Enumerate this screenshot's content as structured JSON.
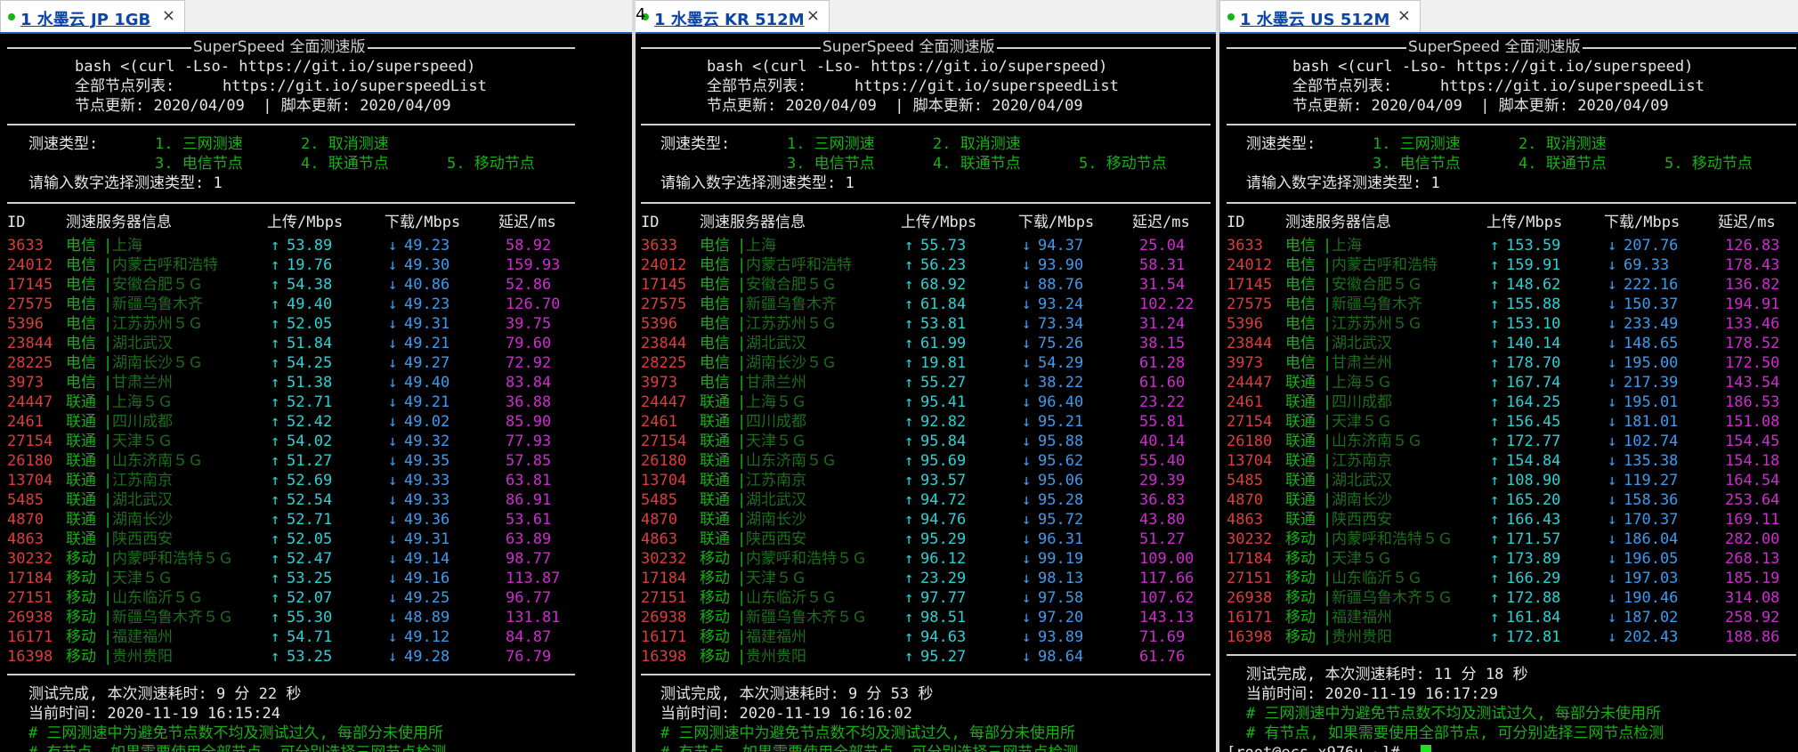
{
  "panes": [
    {
      "tab_title": "1 水墨云 JP 1GB",
      "header": {
        "banner": "SuperSpeed 全面测速版",
        "cmd": "bash <(curl -Lso- https://git.io/superspeed)",
        "list_label": "全部节点列表:",
        "list_url": "https://git.io/superspeedList",
        "update_line": "节点更新: 2020/04/09  | 脚本更新: 2020/04/09"
      },
      "menu": {
        "type_label": "测速类型:",
        "o1": "1. 三网测速",
        "o2": "2. 取消测速",
        "o3": "3. 电信节点",
        "o4": "4. 联通节点",
        "o5": "5. 移动节点",
        "prompt": "请输入数字选择测速类型: 1"
      },
      "columns": [
        "ID",
        "测速服务器信息",
        "上传/Mbps",
        "下载/Mbps",
        "延迟/ms"
      ],
      "rows": [
        [
          "3633",
          "电信",
          "上海",
          "53.89",
          "49.23",
          "58.92"
        ],
        [
          "24012",
          "电信",
          "内蒙古呼和浩特",
          "19.76",
          "49.30",
          "159.93"
        ],
        [
          "17145",
          "电信",
          "安徽合肥５Ｇ",
          "54.38",
          "40.86",
          "52.86"
        ],
        [
          "27575",
          "电信",
          "新疆乌鲁木齐",
          "49.40",
          "49.23",
          "126.70"
        ],
        [
          "5396",
          "电信",
          "江苏苏州５Ｇ",
          "52.05",
          "49.31",
          "39.75"
        ],
        [
          "23844",
          "电信",
          "湖北武汉",
          "51.84",
          "49.21",
          "79.60"
        ],
        [
          "28225",
          "电信",
          "湖南长沙５Ｇ",
          "54.25",
          "49.27",
          "72.92"
        ],
        [
          "3973",
          "电信",
          "甘肃兰州",
          "51.38",
          "49.40",
          "83.84"
        ],
        [
          "24447",
          "联通",
          "上海５Ｇ",
          "52.71",
          "49.21",
          "36.88"
        ],
        [
          "2461",
          "联通",
          "四川成都",
          "52.42",
          "49.02",
          "85.90"
        ],
        [
          "27154",
          "联通",
          "天津５Ｇ",
          "54.02",
          "49.32",
          "77.93"
        ],
        [
          "26180",
          "联通",
          "山东济南５Ｇ",
          "51.27",
          "49.35",
          "57.85"
        ],
        [
          "13704",
          "联通",
          "江苏南京",
          "52.69",
          "49.33",
          "63.81"
        ],
        [
          "5485",
          "联通",
          "湖北武汉",
          "52.54",
          "49.33",
          "86.91"
        ],
        [
          "4870",
          "联通",
          "湖南长沙",
          "52.71",
          "49.36",
          "53.61"
        ],
        [
          "4863",
          "联通",
          "陕西西安",
          "52.05",
          "49.31",
          "63.89"
        ],
        [
          "30232",
          "移动",
          "内蒙呼和浩特５Ｇ",
          "52.47",
          "49.14",
          "98.77"
        ],
        [
          "17184",
          "移动",
          "天津５Ｇ",
          "53.25",
          "49.16",
          "113.87"
        ],
        [
          "27151",
          "移动",
          "山东临沂５Ｇ",
          "52.07",
          "49.25",
          "96.77"
        ],
        [
          "26938",
          "移动",
          "新疆乌鲁木齐５Ｇ",
          "55.30",
          "48.89",
          "131.81"
        ],
        [
          "16171",
          "移动",
          "福建福州",
          "54.71",
          "49.12",
          "84.87"
        ],
        [
          "16398",
          "移动",
          "贵州贵阳",
          "53.25",
          "49.28",
          "76.79"
        ]
      ],
      "footer": {
        "done": "测试完成, 本次测速耗时: 9 分 22 秒",
        "time": "当前时间: 2020-11-19 16:15:24",
        "note1": "# 三网测速中为避免节点数不均及测试过久, 每部分未使用所",
        "note2": "# 有节点, 如果需要使用全部节点, 可分别选择三网节点检测",
        "prompt": ""
      }
    },
    {
      "tab_title": "1 水墨云 KR 512M",
      "stub_label": "4",
      "header": {
        "banner": "SuperSpeed 全面测速版",
        "cmd": "bash <(curl -Lso- https://git.io/superspeed)",
        "list_label": "全部节点列表:",
        "list_url": "https://git.io/superspeedList",
        "update_line": "节点更新: 2020/04/09  | 脚本更新: 2020/04/09"
      },
      "menu": {
        "type_label": "测速类型:",
        "o1": "1. 三网测速",
        "o2": "2. 取消测速",
        "o3": "3. 电信节点",
        "o4": "4. 联通节点",
        "o5": "5. 移动节点",
        "prompt": "请输入数字选择测速类型: 1"
      },
      "columns": [
        "ID",
        "测速服务器信息",
        "上传/Mbps",
        "下载/Mbps",
        "延迟/ms"
      ],
      "rows": [
        [
          "3633",
          "电信",
          "上海",
          "55.73",
          "94.37",
          "25.04"
        ],
        [
          "24012",
          "电信",
          "内蒙古呼和浩特",
          "56.23",
          "93.90",
          "58.31"
        ],
        [
          "17145",
          "电信",
          "安徽合肥５Ｇ",
          "68.92",
          "88.76",
          "31.54"
        ],
        [
          "27575",
          "电信",
          "新疆乌鲁木齐",
          "61.84",
          "93.24",
          "102.22"
        ],
        [
          "5396",
          "电信",
          "江苏苏州５Ｇ",
          "53.81",
          "73.34",
          "31.24"
        ],
        [
          "23844",
          "电信",
          "湖北武汉",
          "61.99",
          "75.26",
          "38.15"
        ],
        [
          "28225",
          "电信",
          "湖南长沙５Ｇ",
          "19.81",
          "54.29",
          "61.28"
        ],
        [
          "3973",
          "电信",
          "甘肃兰州",
          "55.27",
          "38.22",
          "61.60"
        ],
        [
          "24447",
          "联通",
          "上海５Ｇ",
          "95.41",
          "96.40",
          "23.22"
        ],
        [
          "2461",
          "联通",
          "四川成都",
          "92.82",
          "95.21",
          "55.81"
        ],
        [
          "27154",
          "联通",
          "天津５Ｇ",
          "95.84",
          "95.88",
          "40.14"
        ],
        [
          "26180",
          "联通",
          "山东济南５Ｇ",
          "95.69",
          "95.62",
          "55.40"
        ],
        [
          "13704",
          "联通",
          "江苏南京",
          "93.57",
          "95.06",
          "29.39"
        ],
        [
          "5485",
          "联通",
          "湖北武汉",
          "94.72",
          "95.28",
          "36.83"
        ],
        [
          "4870",
          "联通",
          "湖南长沙",
          "94.76",
          "95.72",
          "43.80"
        ],
        [
          "4863",
          "联通",
          "陕西西安",
          "95.29",
          "96.31",
          "51.27"
        ],
        [
          "30232",
          "移动",
          "内蒙呼和浩特５Ｇ",
          "96.12",
          "99.19",
          "109.00"
        ],
        [
          "17184",
          "移动",
          "天津５Ｇ",
          "23.29",
          "98.13",
          "117.66"
        ],
        [
          "27151",
          "移动",
          "山东临沂５Ｇ",
          "97.77",
          "97.58",
          "107.62"
        ],
        [
          "26938",
          "移动",
          "新疆乌鲁木齐５Ｇ",
          "98.51",
          "97.20",
          "143.13"
        ],
        [
          "16171",
          "移动",
          "福建福州",
          "94.63",
          "93.89",
          "71.69"
        ],
        [
          "16398",
          "移动",
          "贵州贵阳",
          "95.27",
          "98.64",
          "61.76"
        ]
      ],
      "footer": {
        "done": "测试完成, 本次测速耗时: 9 分 53 秒",
        "time": "当前时间: 2020-11-19 16:16:02",
        "note1": "# 三网测速中为避免节点数不均及测试过久, 每部分未使用所",
        "note2": "# 有节点, 如果需要使用全部节点, 可分别选择三网节点检测",
        "prompt": ""
      }
    },
    {
      "tab_title": "1 水墨云 US 512M",
      "header": {
        "banner": "SuperSpeed 全面测速版",
        "cmd": "bash <(curl -Lso- https://git.io/superspeed)",
        "list_label": "全部节点列表:",
        "list_url": "https://git.io/superspeedList",
        "update_line": "节点更新: 2020/04/09  | 脚本更新: 2020/04/09"
      },
      "menu": {
        "type_label": "测速类型:",
        "o1": "1. 三网测速",
        "o2": "2. 取消测速",
        "o3": "3. 电信节点",
        "o4": "4. 联通节点",
        "o5": "5. 移动节点",
        "prompt": "请输入数字选择测速类型: 1"
      },
      "columns": [
        "ID",
        "测速服务器信息",
        "上传/Mbps",
        "下载/Mbps",
        "延迟/ms"
      ],
      "rows": [
        [
          "3633",
          "电信",
          "上海",
          "153.59",
          "207.76",
          "126.83"
        ],
        [
          "24012",
          "电信",
          "内蒙古呼和浩特",
          "159.91",
          "69.33",
          "178.43"
        ],
        [
          "17145",
          "电信",
          "安徽合肥５Ｇ",
          "148.62",
          "222.16",
          "136.82"
        ],
        [
          "27575",
          "电信",
          "新疆乌鲁木齐",
          "155.88",
          "150.37",
          "194.91"
        ],
        [
          "5396",
          "电信",
          "江苏苏州５Ｇ",
          "153.10",
          "233.49",
          "133.46"
        ],
        [
          "23844",
          "电信",
          "湖北武汉",
          "140.14",
          "148.65",
          "178.52"
        ],
        [
          "3973",
          "电信",
          "甘肃兰州",
          "178.70",
          "195.00",
          "172.50"
        ],
        [
          "24447",
          "联通",
          "上海５Ｇ",
          "167.74",
          "217.39",
          "143.54"
        ],
        [
          "2461",
          "联通",
          "四川成都",
          "164.25",
          "195.01",
          "186.53"
        ],
        [
          "27154",
          "联通",
          "天津５Ｇ",
          "156.45",
          "181.01",
          "151.08"
        ],
        [
          "26180",
          "联通",
          "山东济南５Ｇ",
          "172.77",
          "102.74",
          "154.45"
        ],
        [
          "13704",
          "联通",
          "江苏南京",
          "154.84",
          "135.38",
          "154.18"
        ],
        [
          "5485",
          "联通",
          "湖北武汉",
          "108.90",
          "119.27",
          "164.54"
        ],
        [
          "4870",
          "联通",
          "湖南长沙",
          "165.20",
          "158.36",
          "253.64"
        ],
        [
          "4863",
          "联通",
          "陕西西安",
          "166.43",
          "170.37",
          "169.11"
        ],
        [
          "30232",
          "移动",
          "内蒙呼和浩特５Ｇ",
          "171.57",
          "186.04",
          "282.00"
        ],
        [
          "17184",
          "移动",
          "天津５Ｇ",
          "173.89",
          "196.05",
          "268.13"
        ],
        [
          "27151",
          "移动",
          "山东临沂５Ｇ",
          "166.29",
          "197.03",
          "185.19"
        ],
        [
          "26938",
          "移动",
          "新疆乌鲁木齐５Ｇ",
          "172.88",
          "190.46",
          "314.08"
        ],
        [
          "16171",
          "移动",
          "福建福州",
          "161.84",
          "187.02",
          "258.92"
        ],
        [
          "16398",
          "移动",
          "贵州贵阳",
          "172.81",
          "202.43",
          "188.86"
        ]
      ],
      "footer": {
        "done": "测试完成, 本次测速耗时: 11 分 18 秒",
        "time": "当前时间: 2020-11-19 16:17:29",
        "note1": "# 三网测速中为避免节点数不均及测试过久, 每部分未使用所",
        "note2": "# 有节点, 如果需要使用全部节点, 可分别选择三网节点检测",
        "prompt": "[root@ecs-x976u ~]# "
      }
    }
  ],
  "glyphs": {
    "up": "↑",
    "down": "↓",
    "close": "×",
    "pipe": "|"
  },
  "colors": {
    "tab_text": "#0a46a8",
    "tab_dot": "#17b317",
    "id": "#e23b3b",
    "isp": "#18b018",
    "loc": "#1c6e1c",
    "up": "#25d4d4",
    "down": "#3a9bf0",
    "ping": "#d22ad2",
    "cursor": "#20e020"
  }
}
